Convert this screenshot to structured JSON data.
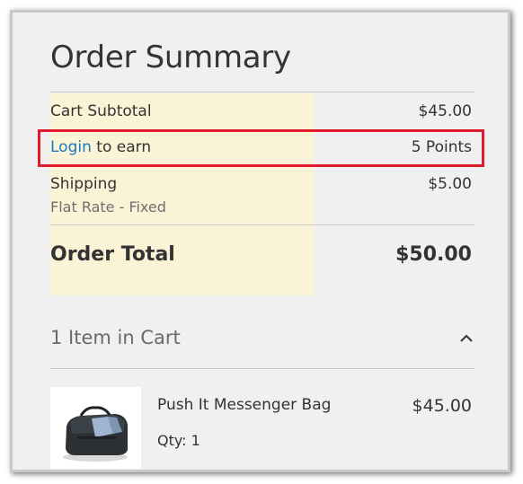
{
  "summary": {
    "title": "Order Summary",
    "subtotal_label": "Cart Subtotal",
    "subtotal_value": "$45.00",
    "login_link": "Login",
    "earn_text": " to earn",
    "points_value": "5 Points",
    "shipping_label": "Shipping",
    "shipping_method": "Flat Rate - Fixed",
    "shipping_value": "$5.00",
    "total_label": "Order Total",
    "total_value": "$50.00"
  },
  "cart": {
    "count_label": "1 Item in Cart",
    "toggle_icon": "chevron-up-icon",
    "items": [
      {
        "name": "Push It Messenger Bag",
        "price": "$45.00",
        "qty_label": "Qty: 1",
        "image_icon": "messenger-bag-image"
      }
    ]
  },
  "colors": {
    "link": "#1979c3",
    "highlight_border": "#e01b2d",
    "highlight_fill": "#fbf3d5",
    "panel_bg": "#f0f0f0"
  }
}
